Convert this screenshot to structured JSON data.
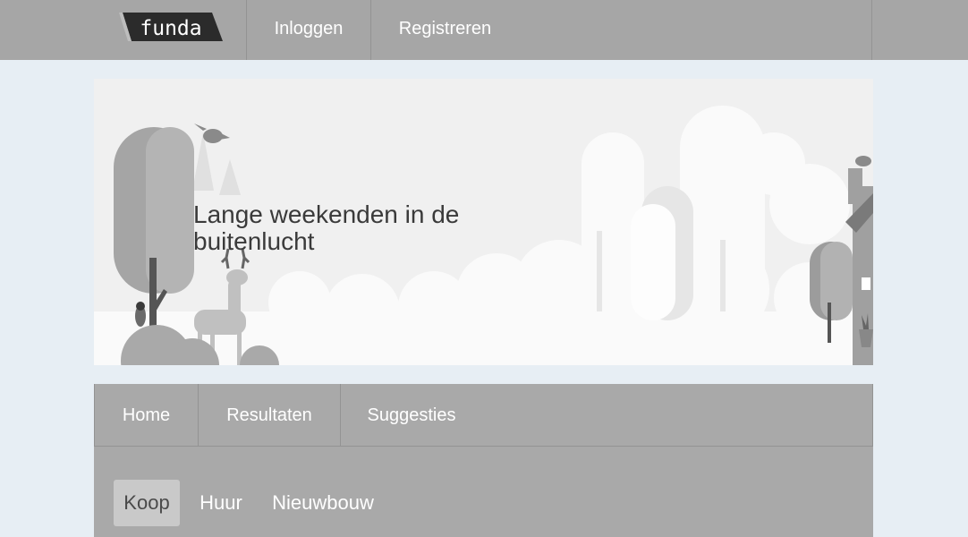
{
  "header": {
    "logo_text": "funda",
    "login_label": "Inloggen",
    "register_label": "Registreren"
  },
  "hero": {
    "title": "Lange weekenden in de buitenlucht"
  },
  "nav": {
    "items": [
      {
        "label": "Home"
      },
      {
        "label": "Resultaten"
      },
      {
        "label": "Suggesties"
      }
    ]
  },
  "search": {
    "tabs": [
      {
        "label": "Koop",
        "selected": true
      },
      {
        "label": "Huur",
        "selected": false
      },
      {
        "label": "Nieuwbouw",
        "selected": false
      }
    ]
  },
  "colors": {
    "page_bg": "#e7eef4",
    "bar_bg": "#a6a6a6",
    "selected_tab_bg": "#c9c9c9"
  }
}
